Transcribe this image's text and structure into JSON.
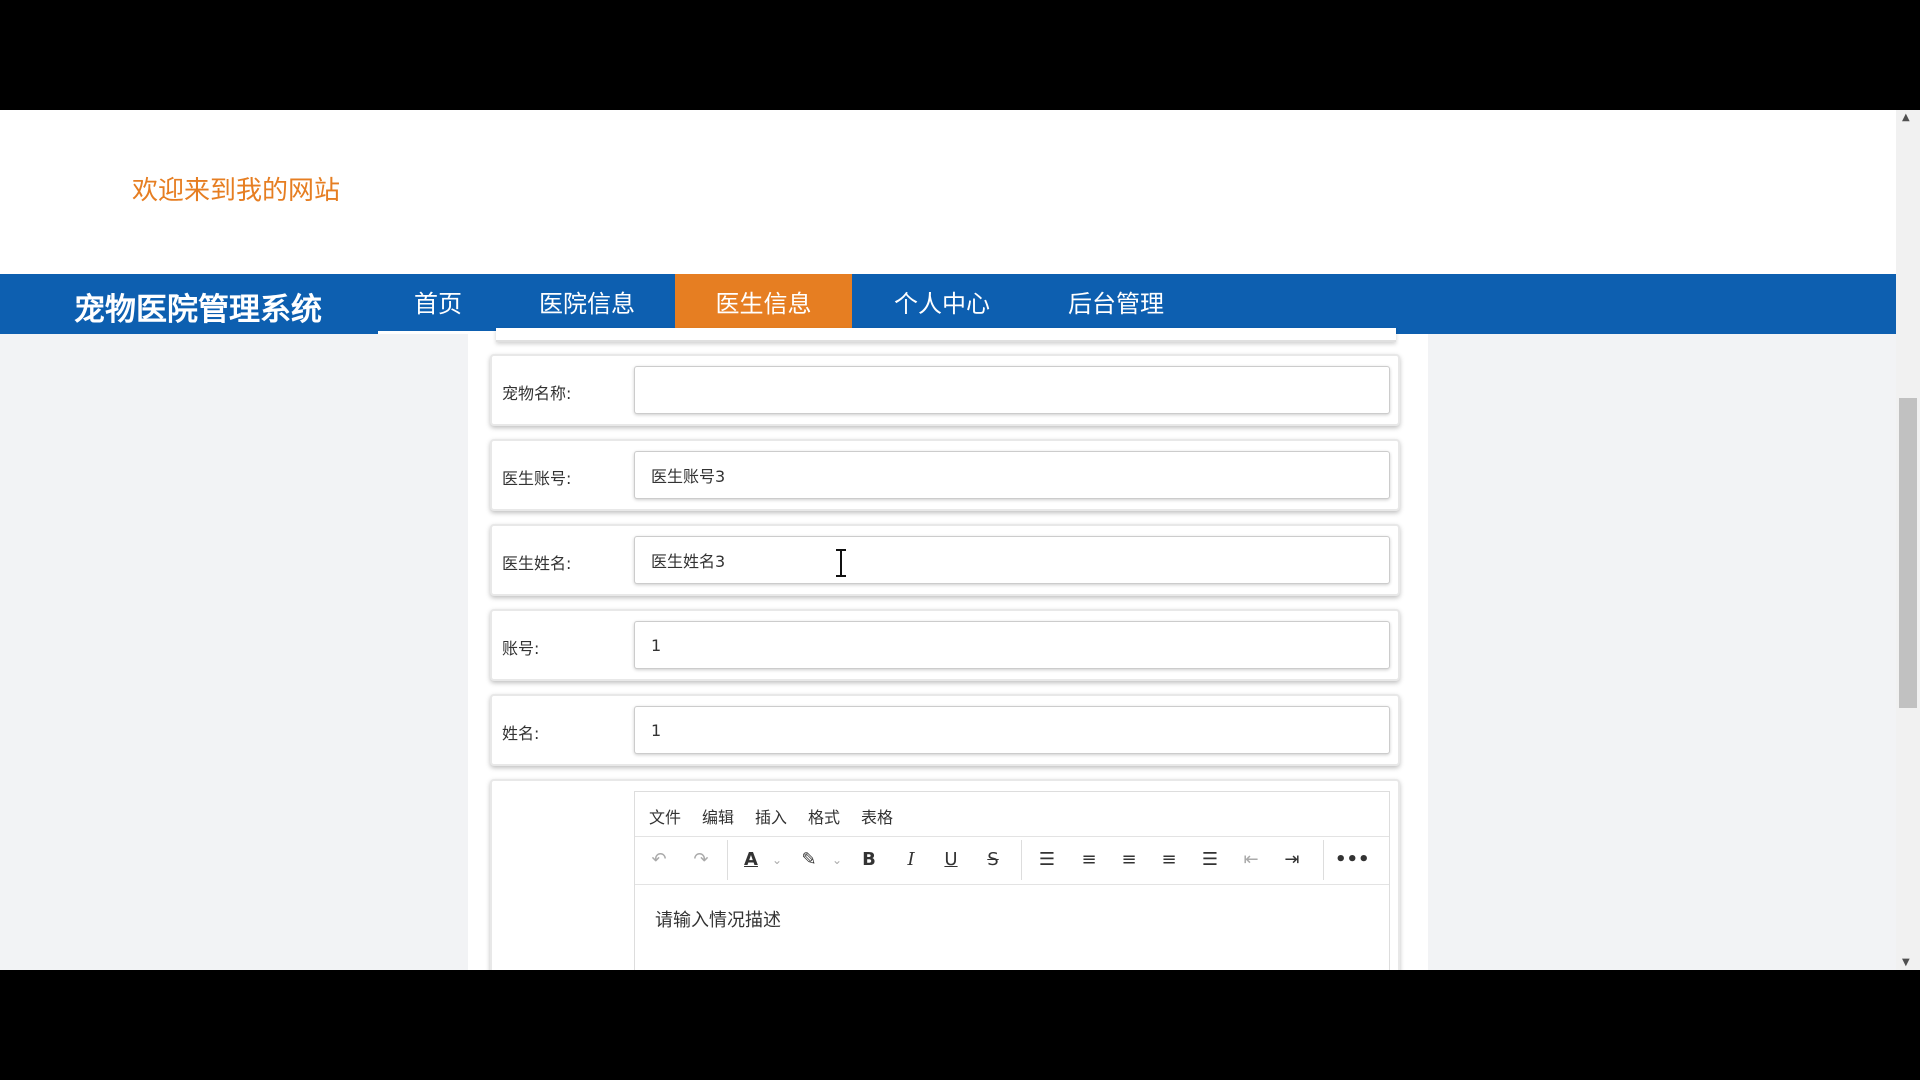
{
  "header": {
    "welcome": "欢迎来到我的网站"
  },
  "nav": {
    "brand": "宠物医院管理系统",
    "items": [
      {
        "label": "首页"
      },
      {
        "label": "医院信息"
      },
      {
        "label": "医生信息",
        "active": true
      },
      {
        "label": "个人中心"
      },
      {
        "label": "后台管理"
      }
    ]
  },
  "form": {
    "fields": [
      {
        "label": "宠物名称:",
        "value": ""
      },
      {
        "label": "医生账号:",
        "value": "医生账号3"
      },
      {
        "label": "医生姓名:",
        "value": "医生姓名3"
      },
      {
        "label": "账号:",
        "value": "1"
      },
      {
        "label": "姓名:",
        "value": "1"
      }
    ],
    "editor": {
      "menus": [
        "文件",
        "编辑",
        "插入",
        "格式",
        "表格"
      ],
      "placeholder": "请输入情况描述",
      "toolbar": [
        "undo-icon",
        "redo-icon",
        "text-color-icon",
        "highlight-icon",
        "bold-icon",
        "italic-icon",
        "underline-icon",
        "strikethrough-icon",
        "numbered-list-icon",
        "align-left-icon",
        "align-center-icon",
        "align-right-icon",
        "align-justify-icon",
        "outdent-icon",
        "indent-icon",
        "more-icon"
      ]
    }
  },
  "colors": {
    "accent": "#e67e22",
    "nav": "#0d5fb0"
  }
}
